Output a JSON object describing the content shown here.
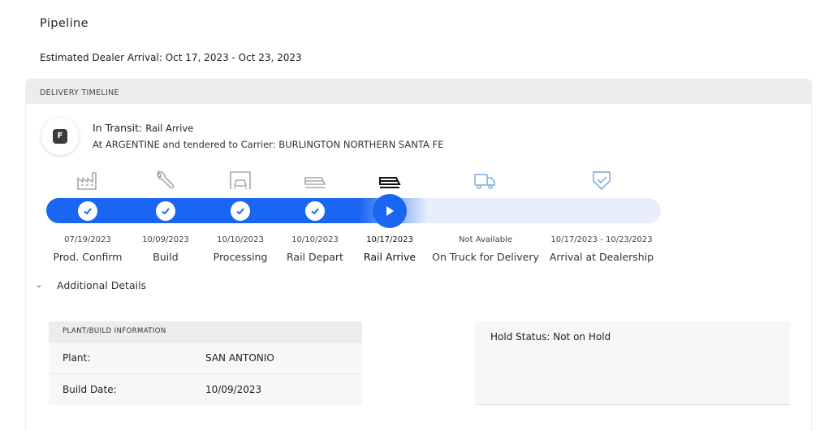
{
  "page_title": "Pipeline",
  "estimated_arrival": "Estimated Dealer Arrival: Oct 17, 2023 - Oct 23, 2023",
  "timeline": {
    "header": "DELIVERY TIMELINE",
    "avatar_letter": "F",
    "status_title": "In Transit:",
    "status_sub": "Rail Arrive",
    "carrier_text": "At ARGENTINE and tendered to Carrier: BURLINGTON NORTHERN SANTA FE",
    "progress_percent": 58,
    "stages": [
      {
        "date": "07/19/2023",
        "label": "Prod. Confirm",
        "icon": "factory-icon",
        "state": "complete"
      },
      {
        "date": "10/09/2023",
        "label": "Build",
        "icon": "wrench-icon",
        "state": "complete"
      },
      {
        "date": "10/10/2023",
        "label": "Processing",
        "icon": "car-wash-icon",
        "state": "complete"
      },
      {
        "date": "10/10/2023",
        "label": "Rail Depart",
        "icon": "train-icon",
        "state": "complete"
      },
      {
        "date": "10/17/2023",
        "label": "Rail Arrive",
        "icon": "train-icon",
        "state": "current"
      },
      {
        "date": "Not Available",
        "label": "On Truck for Delivery",
        "icon": "truck-icon",
        "state": "upcoming"
      },
      {
        "date": "10/17/2023 - 10/23/2023",
        "label": "Arrival at Dealership",
        "icon": "shield-check-icon",
        "state": "upcoming"
      }
    ]
  },
  "additional_details": {
    "toggle_label": "Additional Details",
    "plant_info": {
      "header": "PLANT/BUILD INFORMATION",
      "rows": [
        {
          "key": "Plant:",
          "value": "SAN ANTONIO"
        },
        {
          "key": "Build Date:",
          "value": "10/09/2023"
        }
      ]
    },
    "hold_status": "Hold Status: Not on Hold"
  },
  "colors": {
    "progress_blue": "#1a66f2",
    "track_light": "#e8eefb",
    "upcoming_icon": "#8ab8e8",
    "done_icon": "#a8a8a8"
  }
}
